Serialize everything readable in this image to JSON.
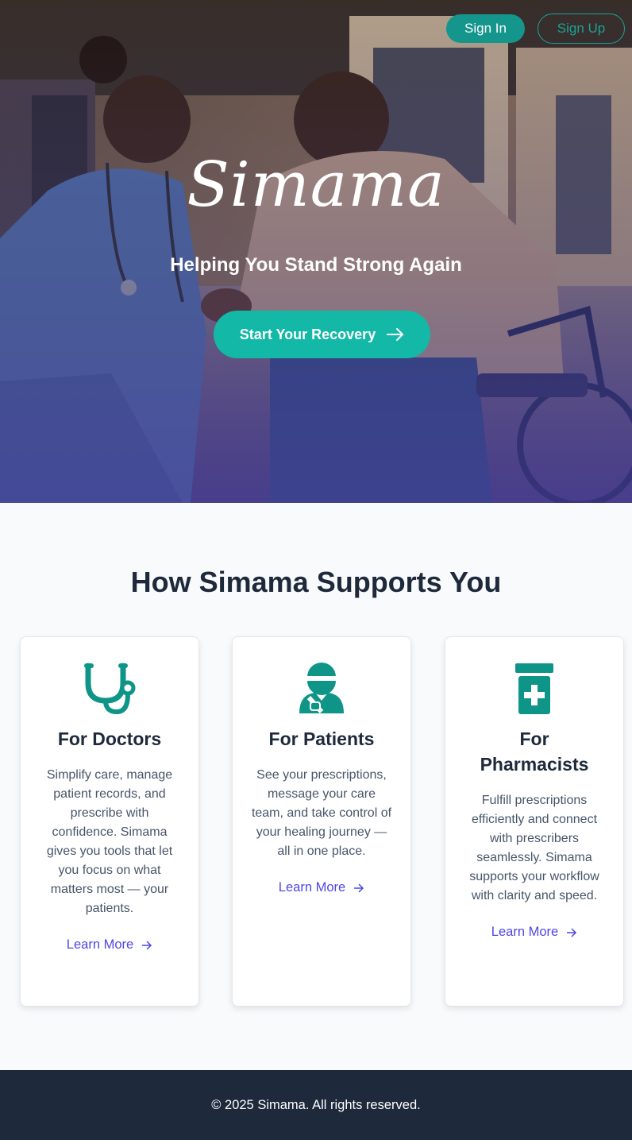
{
  "nav": {
    "sign_in": "Sign In",
    "sign_up": "Sign Up"
  },
  "hero": {
    "brand": "Simama",
    "tagline": "Helping You Stand Strong Again",
    "cta": "Start Your Recovery",
    "photo_icon": "nurse-helping-wheelchair-user-photo"
  },
  "section": {
    "title": "How Simama Supports You",
    "cards": [
      {
        "icon": "stethoscope-icon",
        "title": "For Doctors",
        "text": "Simplify care, manage patient records, and prescribe with confidence. Simama gives you tools that let you focus on what matters most — your patients.",
        "link": "Learn More"
      },
      {
        "icon": "injured-patient-icon",
        "title": "For Patients",
        "text": "See your prescriptions, message your care team, and take control of your healing journey — all in one place.",
        "link": "Learn More"
      },
      {
        "icon": "prescription-bottle-icon",
        "title": "For Pharmacists",
        "text": "Fulfill prescriptions efficiently and connect with prescribers seamlessly. Simama supports your workflow with clarity and speed.",
        "link": "Learn More"
      }
    ]
  },
  "footer": {
    "text": "© 2025 Simama. All rights reserved."
  },
  "colors": {
    "teal": "#14b8a6",
    "teal_dark": "#0f9488",
    "link": "#4f46e5",
    "footer_bg": "#1e293b"
  }
}
